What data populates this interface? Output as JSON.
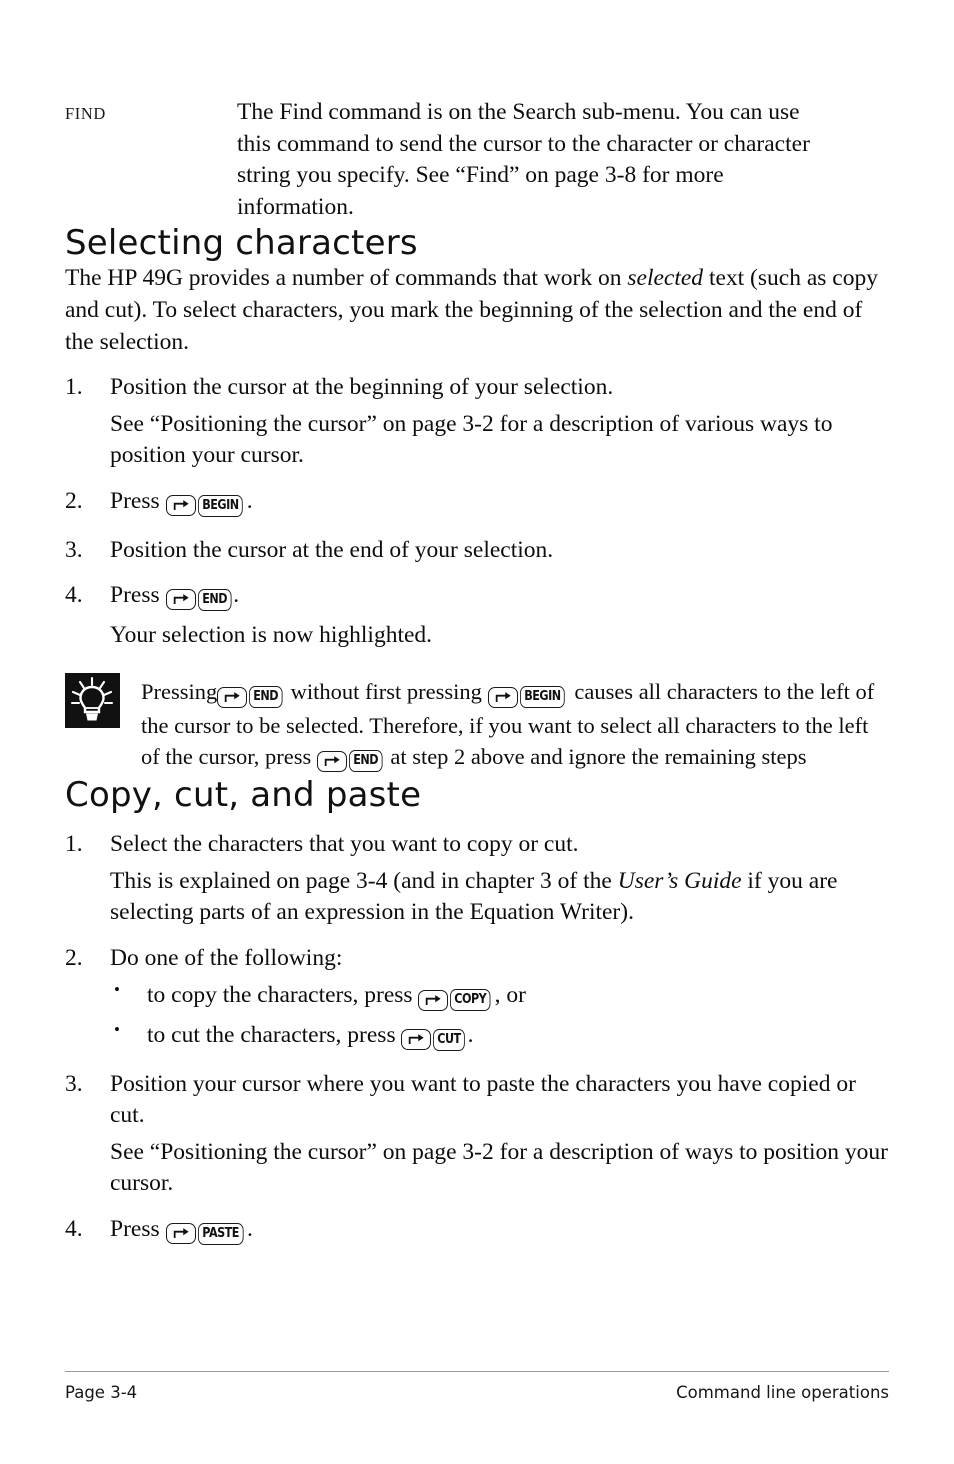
{
  "document": {
    "page_label": "Page 3-4",
    "running_foot": "Command line operations"
  },
  "definition": {
    "term": "FIND",
    "description": "The Find command is on the Search sub-menu. You can use this command to send the cursor to the character or character string you specify. See “Find” on page 3-8 for more information."
  },
  "sections": [
    {
      "heading": "Selecting characters",
      "intro": {
        "part1": "The HP 49G provides a number of commands that work on ",
        "emphasis": "selected",
        "part2": " text (such as copy and cut). To select characters, you mark the beginning of the selection and the end of the selection."
      },
      "steps": [
        {
          "num": "1.",
          "text": "Position the cursor at the beginning of your selection.",
          "sub": "See “Positioning the cursor” on page 3-2 for a description of various ways to position your cursor."
        },
        {
          "num": "2.",
          "press_label": "Press ",
          "key_shift": "↱",
          "key_label": "BEGIN",
          "trailing": "."
        },
        {
          "num": "3.",
          "text": "Position the cursor at the end of your selection."
        },
        {
          "num": "4.",
          "press_label": "Press ",
          "key_shift": "↱",
          "key_label": "END",
          "trailing": ".",
          "sub": "Your selection is now highlighted."
        }
      ],
      "tip": {
        "icon": "lightbulb-icon",
        "t1": " Pressing",
        "k1": "END",
        "t2": " without first pressing ",
        "k2": "BEGIN",
        "t3": " causes all characters to the left of the cursor to be selected. Therefore, if you want to select all characters to the left of the cursor, press ",
        "k3": "END",
        "t4": " at step 2 above and ignore the remaining steps"
      }
    },
    {
      "heading": "Copy, cut, and paste",
      "steps": [
        {
          "num": "1.",
          "text": "Select the characters that you want to copy or cut.",
          "sub_part1": "This is explained on page 3-4 (and in chapter 3 of the ",
          "sub_emphasis": "User’s Guide",
          "sub_part2": " if you are selecting parts of an expression in the Equation Writer)."
        },
        {
          "num": "2.",
          "text": "Do one of the following:",
          "bullets": [
            {
              "dot": "•",
              "pre": "to copy the characters, press ",
              "key_label": "COPY",
              "post": ", or"
            },
            {
              "dot": "•",
              "pre": "to cut the characters, press ",
              "key_label": "CUT",
              "post": "."
            }
          ]
        },
        {
          "num": "3.",
          "text": "Position your cursor where you want to paste the characters you have copied or cut.",
          "sub": "See “Positioning the cursor” on page 3-2 for a description of ways to position your cursor."
        },
        {
          "num": "4.",
          "press_label": "Press ",
          "key_label": "PASTE",
          "trailing": "."
        }
      ]
    }
  ],
  "colors": {
    "ink": "#0d0d0d",
    "rule": "#9a9a9a",
    "tip_icon_bg": "#111111"
  }
}
